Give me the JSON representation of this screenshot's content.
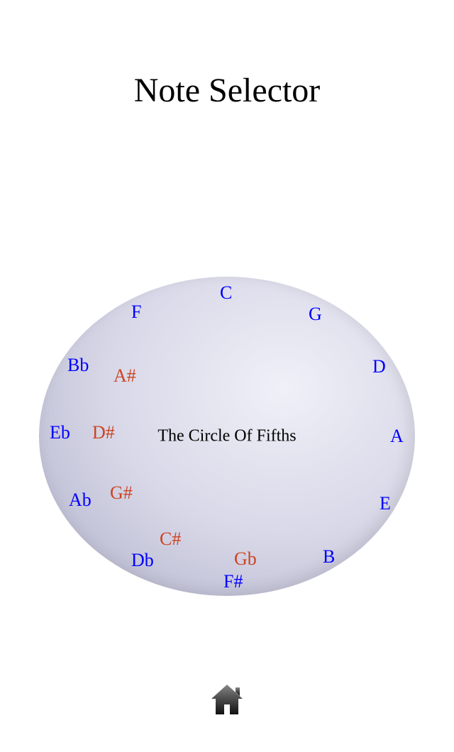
{
  "title": "Note Selector",
  "circle": {
    "centerLabel": "The Circle Of Fifths",
    "notes": {
      "c": "C",
      "g": "G",
      "d": "D",
      "a": "A",
      "e": "E",
      "b": "B",
      "fsharp": "F#",
      "gb": "Gb",
      "csharp": "C#",
      "db": "Db",
      "gsharp": "G#",
      "ab": "Ab",
      "dsharp": "D#",
      "eb": "Eb",
      "asharp": "A#",
      "bb": "Bb",
      "f": "F"
    }
  }
}
